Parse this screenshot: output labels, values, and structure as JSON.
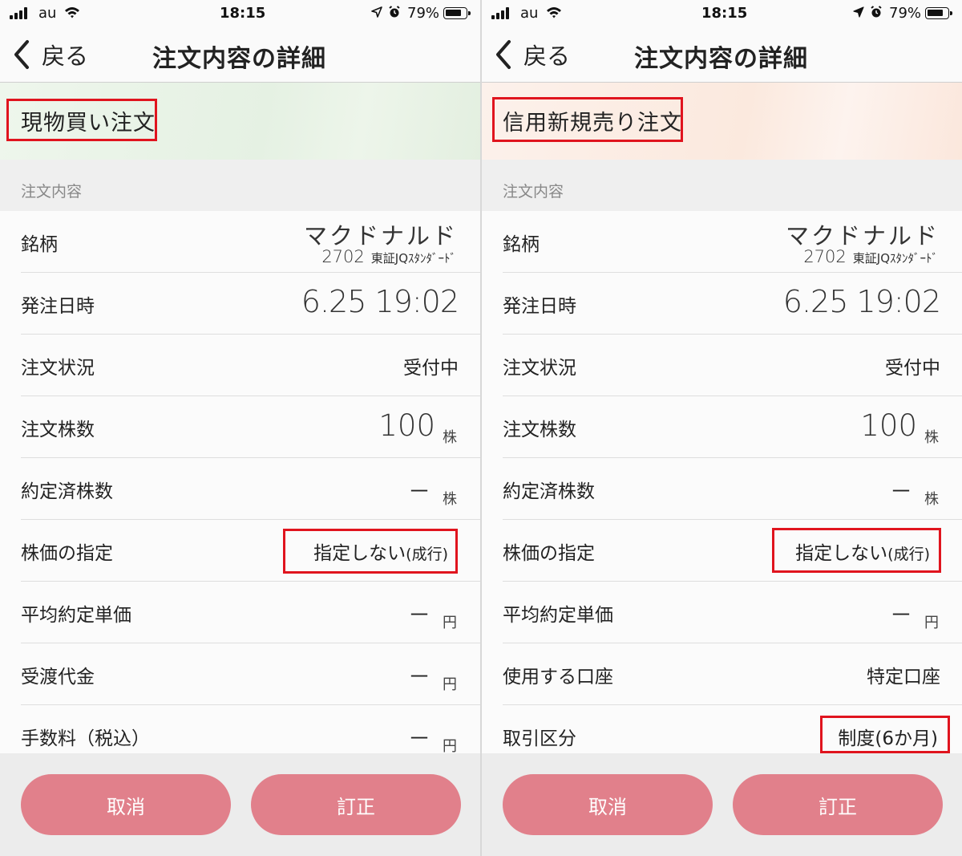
{
  "status_bar": {
    "carrier": "au",
    "time": "18:15",
    "battery_pct": "79%",
    "battery_level": 0.79,
    "icons": [
      "signal-icon",
      "wifi-icon",
      "location-icon",
      "alarm-icon",
      "battery-icon"
    ]
  },
  "left_screen": {
    "back_label": "戻る",
    "title": "注文内容の詳細",
    "order_type": "現物買い注文",
    "section": "注文内容",
    "stock": {
      "label": "銘柄",
      "name": "マクドナルド",
      "code": "2702",
      "market": "東証JQｽﾀﾝﾀﾞｰﾄﾞ"
    },
    "order_datetime": {
      "label": "発注日時",
      "value": "6.25 19:02"
    },
    "status": {
      "label": "注文状況",
      "value": "受付中"
    },
    "quantity": {
      "label": "注文株数",
      "value": "100",
      "unit": "株"
    },
    "executed_qty": {
      "label": "約定済株数",
      "value": "－",
      "unit": "株"
    },
    "price_spec": {
      "label": "株価の指定",
      "value": "指定しない",
      "suffix": "(成行)"
    },
    "avg_price": {
      "label": "平均約定単価",
      "value": "－",
      "unit": "円"
    },
    "settlement": {
      "label": "受渡代金",
      "value": "－",
      "unit": "円"
    },
    "fee": {
      "label": "手数料（税込）",
      "value": "－",
      "unit": "円"
    },
    "cancel_button": "取消",
    "edit_button": "訂正"
  },
  "right_screen": {
    "back_label": "戻る",
    "title": "注文内容の詳細",
    "order_type": "信用新規売り注文",
    "section": "注文内容",
    "stock": {
      "label": "銘柄",
      "name": "マクドナルド",
      "code": "2702",
      "market": "東証JQｽﾀﾝﾀﾞｰﾄﾞ"
    },
    "order_datetime": {
      "label": "発注日時",
      "value": "6.25 19:02"
    },
    "status": {
      "label": "注文状況",
      "value": "受付中"
    },
    "quantity": {
      "label": "注文株数",
      "value": "100",
      "unit": "株"
    },
    "executed_qty": {
      "label": "約定済株数",
      "value": "－",
      "unit": "株"
    },
    "price_spec": {
      "label": "株価の指定",
      "value": "指定しない",
      "suffix": "(成行)"
    },
    "avg_price": {
      "label": "平均約定単価",
      "value": "－",
      "unit": "円"
    },
    "account": {
      "label": "使用する口座",
      "value": "特定口座"
    },
    "trade_class": {
      "label": "取引区分",
      "value": "制度(6か月)"
    },
    "cancel_button": "取消",
    "edit_button": "訂正"
  },
  "colors": {
    "highlight_border": "#e0141e",
    "button": "#e1808b"
  }
}
